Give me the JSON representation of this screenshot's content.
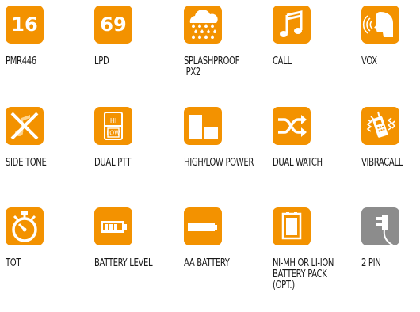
{
  "colors": {
    "accent": "#f39200",
    "muted": "#8c8c8c",
    "text": "#1a1a1a"
  },
  "items": [
    {
      "number": "16",
      "label": "PMR446"
    },
    {
      "number": "69",
      "label": "LPD"
    },
    {
      "icon": "rain-cloud-icon",
      "label": "SPLASHPROOF\nIPX2"
    },
    {
      "icon": "music-note-icon",
      "label": "CALL"
    },
    {
      "icon": "voice-head-icon",
      "label": "VOX"
    },
    {
      "icon": "muted-note-icon",
      "label": "SIDE TONE"
    },
    {
      "icon": "ptt-switch-icon",
      "hi": "HI",
      "low": "LOW",
      "label": "DUAL PTT"
    },
    {
      "icon": "power-blocks-icon",
      "label": "HIGH/LOW POWER"
    },
    {
      "icon": "crossing-arrows-icon",
      "label": "DUAL WATCH"
    },
    {
      "icon": "vibrating-radio-icon",
      "label": "VIBRACALL"
    },
    {
      "icon": "stopwatch-icon",
      "label": "TOT"
    },
    {
      "icon": "battery-level-icon",
      "label": "BATTERY LEVEL"
    },
    {
      "icon": "aa-battery-icon",
      "label": "AA BATTERY"
    },
    {
      "icon": "battery-pack-icon",
      "label": "NI-MH OR LI-ION\nBATTERY PACK\n(OPT.)"
    },
    {
      "icon": "two-pin-plug-icon",
      "label": "2 PIN"
    }
  ]
}
